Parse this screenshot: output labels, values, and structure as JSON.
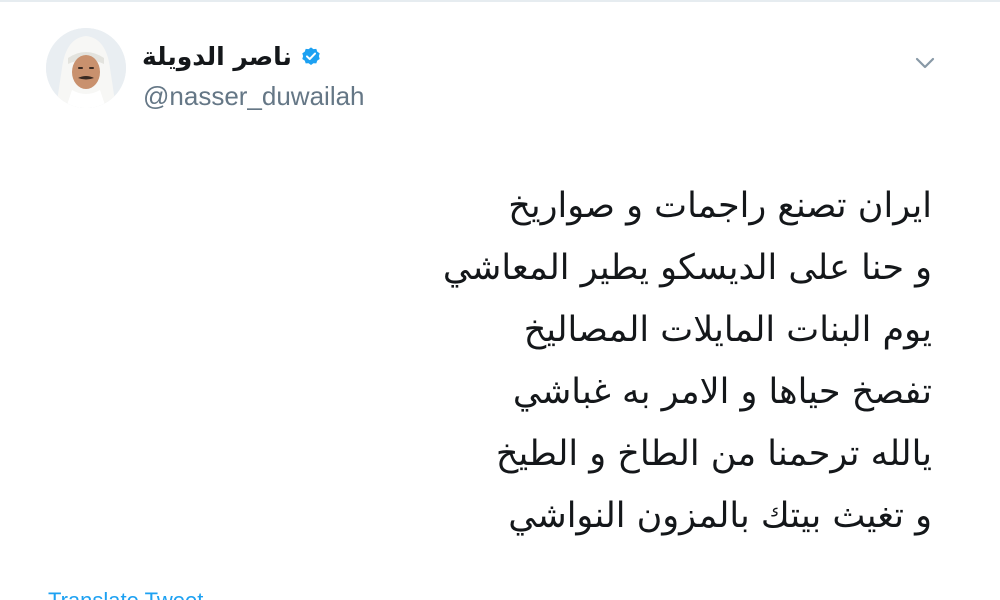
{
  "colors": {
    "text": "#14171a",
    "secondary": "#657786",
    "link": "#1da1f2",
    "verified_badge": "#1da1f2"
  },
  "icons": {
    "verified": "verified-badge-icon",
    "caret": "chevron-down-icon"
  },
  "author": {
    "display_name": "ناصر الدويلة",
    "handle": "@nasser_duwailah",
    "verified": true
  },
  "tweet": {
    "lines": [
      "ايران تصنع راجمات و صواريخ",
      "و حنا على الديسكو يطير المعاشي",
      "يوم البنات المايلات المصاليخ",
      "تفصخ حياها و الامر به غباشي",
      "يالله ترحمنا من الطاخ و الطيخ",
      "و تغيث بيتك بالمزون النواشي"
    ],
    "translate_label": "Translate Tweet"
  }
}
